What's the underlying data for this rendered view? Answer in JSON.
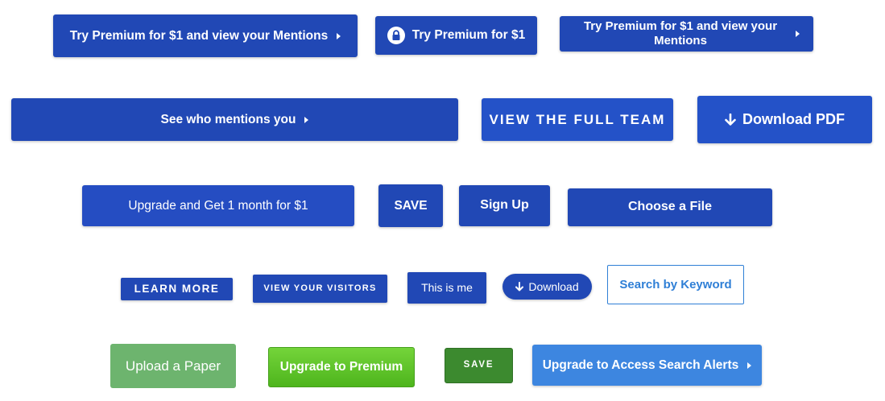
{
  "buttons": {
    "try_premium_mentions": "Try Premium for $1 and view your Mentions",
    "try_premium_lock": "Try Premium for $1",
    "try_premium_mentions_wrapped": "Try Premium for $1 and view your Mentions",
    "see_who_mentions": "See who mentions you",
    "view_full_team": "VIEW THE FULL TEAM",
    "download_pdf": "Download PDF",
    "upgrade_month": "Upgrade and Get 1 month for $1",
    "save_blue": "SAVE",
    "sign_up": "Sign Up",
    "choose_file": "Choose a File",
    "learn_more": "LEARN MORE",
    "view_visitors": "VIEW YOUR VISITORS",
    "this_is_me": "This is me",
    "download_pill": "Download",
    "search_keyword": "Search by Keyword",
    "upload_paper": "Upload a Paper",
    "upgrade_premium": "Upgrade to Premium",
    "save_green": "SAVE",
    "upgrade_search_alerts": "Upgrade to Access Search Alerts"
  },
  "icons": {
    "caret": "caret-right-icon",
    "lock": "lock-icon",
    "download": "download-arrow-icon"
  },
  "colors": {
    "primary_blue": "#2148b5",
    "light_blue": "#3d86e0",
    "outline_blue": "#2f7fd6",
    "green_light": "#6db46e",
    "green_bright": "#5cc628",
    "green_dark": "#3c8a2f"
  }
}
